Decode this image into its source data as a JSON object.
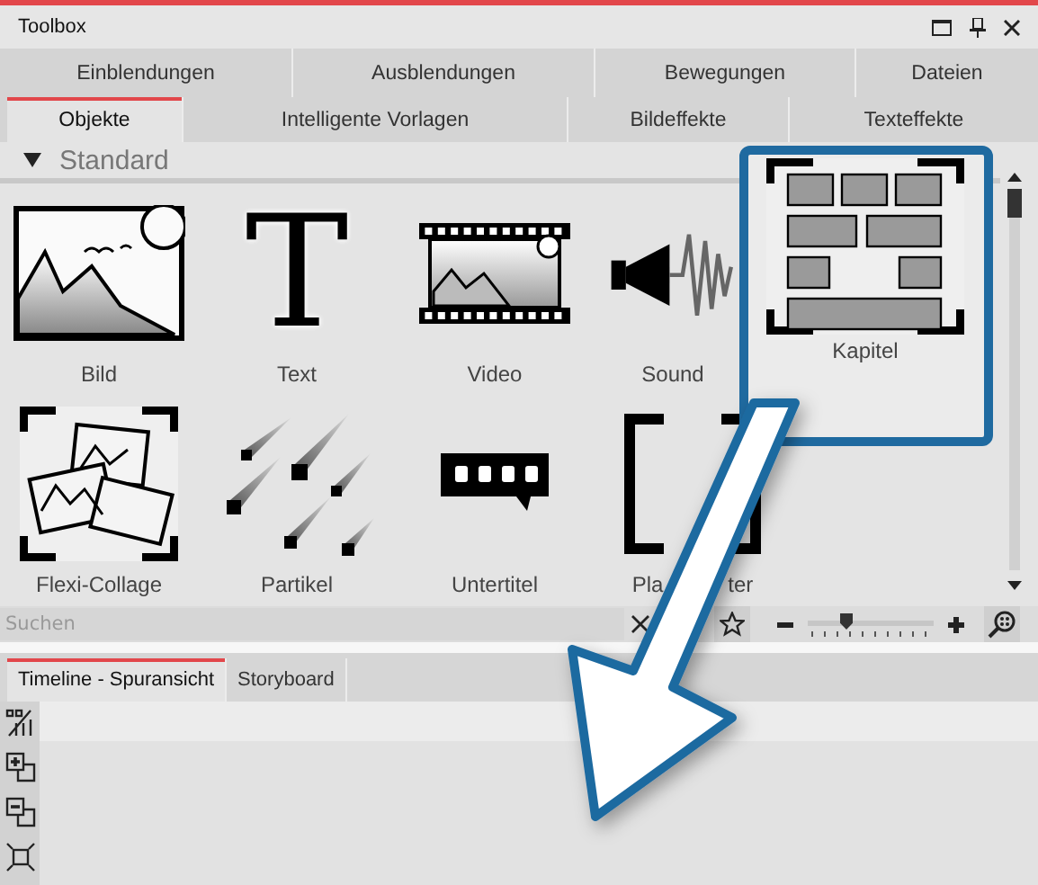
{
  "window": {
    "title": "Toolbox"
  },
  "tabs_row_1": [
    {
      "label": "Einblendungen",
      "selected": false
    },
    {
      "label": "Ausblendungen",
      "selected": false
    },
    {
      "label": "Bewegungen",
      "selected": false
    },
    {
      "label": "Dateien",
      "selected": false
    }
  ],
  "tabs_row_2": [
    {
      "label": "Objekte",
      "selected": true
    },
    {
      "label": "Intelligente Vorlagen",
      "selected": false
    },
    {
      "label": "Bildeffekte",
      "selected": false
    },
    {
      "label": "Texteffekte",
      "selected": false
    }
  ],
  "section": {
    "title": "Standard",
    "expanded": true
  },
  "items": [
    {
      "label": "Bild",
      "kind": "image",
      "highlighted": false
    },
    {
      "label": "Text",
      "kind": "text",
      "glyph": "T",
      "highlighted": false
    },
    {
      "label": "Video",
      "kind": "video",
      "highlighted": false
    },
    {
      "label": "Sound",
      "kind": "sound",
      "highlighted": false
    },
    {
      "label": "Kapitel",
      "kind": "chapter",
      "highlighted": true
    },
    {
      "label": "Flexi-Collage",
      "kind": "collage",
      "highlighted": false
    },
    {
      "label": "Partikel",
      "kind": "particles",
      "highlighted": false
    },
    {
      "label": "Untertitel",
      "kind": "subtitle",
      "highlighted": false
    },
    {
      "label_parts": [
        "Pla",
        "ter"
      ],
      "kind": "placeholder",
      "highlighted": false
    }
  ],
  "search": {
    "placeholder": "Suchen"
  },
  "zoom_slider": {
    "level": 0.3
  },
  "bottom_tabs": [
    {
      "label": "Timeline - Spuransicht",
      "selected": true
    },
    {
      "label": "Storyboard",
      "selected": false
    }
  ]
}
